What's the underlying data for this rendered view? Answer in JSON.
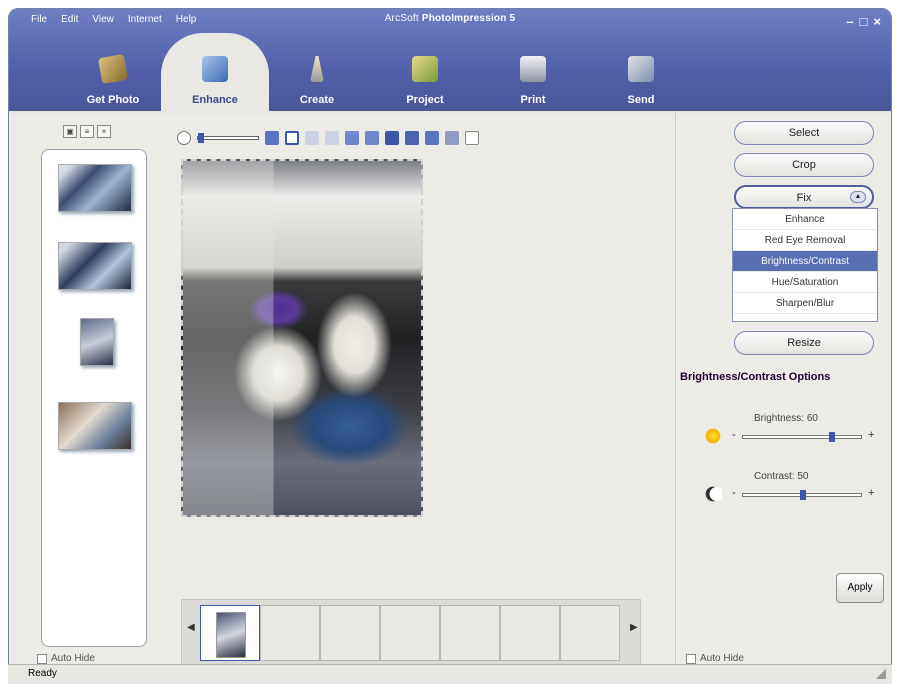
{
  "menu": [
    "File",
    "Edit",
    "View",
    "Internet",
    "Help"
  ],
  "app_title_prefix": "ArcSoft",
  "app_title_name": "PhotoImpression 5",
  "window_controls": {
    "minimize": "–",
    "maximize": "□",
    "close": "×"
  },
  "tabs": [
    {
      "label": "Get Photo",
      "icon": "camera-icon"
    },
    {
      "label": "Enhance",
      "icon": "enhance-icon"
    },
    {
      "label": "Create",
      "icon": "create-icon"
    },
    {
      "label": "Project",
      "icon": "project-icon"
    },
    {
      "label": "Print",
      "icon": "printer-icon"
    },
    {
      "label": "Send",
      "icon": "send-icon"
    }
  ],
  "active_tab": "Enhance",
  "left_autohide": "Auto Hide",
  "right_autohide": "Auto Hide",
  "buttons": {
    "select": "Select",
    "crop": "Crop",
    "fix": "Fix",
    "resize": "Resize",
    "apply": "Apply"
  },
  "fix_menu": [
    "Enhance",
    "Red Eye Removal",
    "Brightness/Contrast",
    "Hue/Saturation",
    "Sharpen/Blur"
  ],
  "fix_menu_selected": "Brightness/Contrast",
  "options_title": "Brightness/Contrast Options",
  "brightness": {
    "label": "Brightness:",
    "value": "60",
    "level_pct": 75
  },
  "contrast": {
    "label": "Contrast:",
    "value": "50",
    "level_pct": 50
  },
  "slider_minus": "-",
  "slider_plus": "+",
  "status": "Ready",
  "colors": {
    "titlebar": "#525fa9",
    "accent": "#3d57a8",
    "selected": "#5a6fb3"
  }
}
